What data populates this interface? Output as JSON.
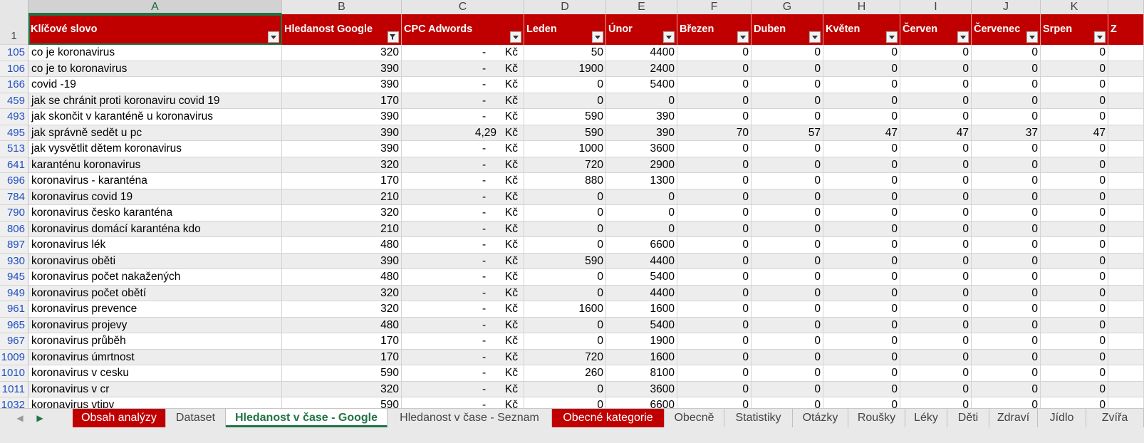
{
  "columns": [
    "A",
    "B",
    "C",
    "D",
    "E",
    "F",
    "G",
    "H",
    "I",
    "J",
    "K"
  ],
  "selected_column": "A",
  "header_row_number": "1",
  "headers": [
    "Klíčové slovo",
    "Hledanost Google",
    "CPC Adwords",
    "Leden",
    "Únor",
    "Březen",
    "Duben",
    "Květen",
    "Červen",
    "Červenec",
    "Srpen",
    "Z"
  ],
  "currency": "Kč",
  "dash": "-",
  "rows": [
    {
      "n": "105",
      "kw": "co je koronavirus",
      "b": "320",
      "cpc": "",
      "d": "50",
      "e": "4400",
      "f": "0",
      "g": "0",
      "h": "0",
      "i": "0",
      "j": "0",
      "k": "0"
    },
    {
      "n": "106",
      "kw": "co je to koronavirus",
      "b": "390",
      "cpc": "",
      "d": "1900",
      "e": "2400",
      "f": "0",
      "g": "0",
      "h": "0",
      "i": "0",
      "j": "0",
      "k": "0"
    },
    {
      "n": "166",
      "kw": "covid -19",
      "b": "390",
      "cpc": "",
      "d": "0",
      "e": "5400",
      "f": "0",
      "g": "0",
      "h": "0",
      "i": "0",
      "j": "0",
      "k": "0"
    },
    {
      "n": "459",
      "kw": "jak se chránit proti koronaviru covid 19",
      "b": "170",
      "cpc": "",
      "d": "0",
      "e": "0",
      "f": "0",
      "g": "0",
      "h": "0",
      "i": "0",
      "j": "0",
      "k": "0"
    },
    {
      "n": "493",
      "kw": "jak skončit v karanténě u koronavirus",
      "b": "390",
      "cpc": "",
      "d": "590",
      "e": "390",
      "f": "0",
      "g": "0",
      "h": "0",
      "i": "0",
      "j": "0",
      "k": "0"
    },
    {
      "n": "495",
      "kw": "jak správně sedět u pc",
      "b": "390",
      "cpc": "4,29",
      "d": "590",
      "e": "390",
      "f": "70",
      "g": "57",
      "h": "47",
      "i": "47",
      "j": "37",
      "k": "47"
    },
    {
      "n": "513",
      "kw": "jak vysvětlit dětem koronavirus",
      "b": "390",
      "cpc": "",
      "d": "1000",
      "e": "3600",
      "f": "0",
      "g": "0",
      "h": "0",
      "i": "0",
      "j": "0",
      "k": "0"
    },
    {
      "n": "641",
      "kw": "karanténu koronavirus",
      "b": "320",
      "cpc": "",
      "d": "720",
      "e": "2900",
      "f": "0",
      "g": "0",
      "h": "0",
      "i": "0",
      "j": "0",
      "k": "0"
    },
    {
      "n": "696",
      "kw": "koronavirus - karanténa",
      "b": "170",
      "cpc": "",
      "d": "880",
      "e": "1300",
      "f": "0",
      "g": "0",
      "h": "0",
      "i": "0",
      "j": "0",
      "k": "0"
    },
    {
      "n": "784",
      "kw": "koronavirus covid 19",
      "b": "210",
      "cpc": "",
      "d": "0",
      "e": "0",
      "f": "0",
      "g": "0",
      "h": "0",
      "i": "0",
      "j": "0",
      "k": "0"
    },
    {
      "n": "790",
      "kw": "koronavirus česko karanténa",
      "b": "320",
      "cpc": "",
      "d": "0",
      "e": "0",
      "f": "0",
      "g": "0",
      "h": "0",
      "i": "0",
      "j": "0",
      "k": "0"
    },
    {
      "n": "806",
      "kw": "koronavirus domácí karanténa kdo",
      "b": "210",
      "cpc": "",
      "d": "0",
      "e": "0",
      "f": "0",
      "g": "0",
      "h": "0",
      "i": "0",
      "j": "0",
      "k": "0"
    },
    {
      "n": "897",
      "kw": "koronavirus lék",
      "b": "480",
      "cpc": "",
      "d": "0",
      "e": "6600",
      "f": "0",
      "g": "0",
      "h": "0",
      "i": "0",
      "j": "0",
      "k": "0"
    },
    {
      "n": "930",
      "kw": "koronavirus oběti",
      "b": "390",
      "cpc": "",
      "d": "590",
      "e": "4400",
      "f": "0",
      "g": "0",
      "h": "0",
      "i": "0",
      "j": "0",
      "k": "0"
    },
    {
      "n": "945",
      "kw": "koronavirus počet nakažených",
      "b": "480",
      "cpc": "",
      "d": "0",
      "e": "5400",
      "f": "0",
      "g": "0",
      "h": "0",
      "i": "0",
      "j": "0",
      "k": "0"
    },
    {
      "n": "949",
      "kw": "koronavirus počet obětí",
      "b": "320",
      "cpc": "",
      "d": "0",
      "e": "4400",
      "f": "0",
      "g": "0",
      "h": "0",
      "i": "0",
      "j": "0",
      "k": "0"
    },
    {
      "n": "961",
      "kw": "koronavirus prevence",
      "b": "320",
      "cpc": "",
      "d": "1600",
      "e": "1600",
      "f": "0",
      "g": "0",
      "h": "0",
      "i": "0",
      "j": "0",
      "k": "0"
    },
    {
      "n": "965",
      "kw": "koronavirus projevy",
      "b": "480",
      "cpc": "",
      "d": "0",
      "e": "5400",
      "f": "0",
      "g": "0",
      "h": "0",
      "i": "0",
      "j": "0",
      "k": "0"
    },
    {
      "n": "967",
      "kw": "koronavirus průběh",
      "b": "170",
      "cpc": "",
      "d": "0",
      "e": "1900",
      "f": "0",
      "g": "0",
      "h": "0",
      "i": "0",
      "j": "0",
      "k": "0"
    },
    {
      "n": "1009",
      "kw": "koronavirus úmrtnost",
      "b": "170",
      "cpc": "",
      "d": "720",
      "e": "1600",
      "f": "0",
      "g": "0",
      "h": "0",
      "i": "0",
      "j": "0",
      "k": "0"
    },
    {
      "n": "1010",
      "kw": "koronavirus v cesku",
      "b": "590",
      "cpc": "",
      "d": "260",
      "e": "8100",
      "f": "0",
      "g": "0",
      "h": "0",
      "i": "0",
      "j": "0",
      "k": "0"
    },
    {
      "n": "1011",
      "kw": "koronavirus v cr",
      "b": "320",
      "cpc": "",
      "d": "0",
      "e": "3600",
      "f": "0",
      "g": "0",
      "h": "0",
      "i": "0",
      "j": "0",
      "k": "0"
    },
    {
      "n": "1032",
      "kw": "koronavirus vtipy",
      "b": "590",
      "cpc": "",
      "d": "0",
      "e": "6600",
      "f": "0",
      "g": "0",
      "h": "0",
      "i": "0",
      "j": "0",
      "k": "0"
    }
  ],
  "sheet_tabs": [
    {
      "label": "Obsah analýzy",
      "style": "red"
    },
    {
      "label": "Dataset",
      "style": "normal"
    },
    {
      "label": "Hledanost v čase - Google",
      "style": "active"
    },
    {
      "label": "Hledanost v čase - Seznam",
      "style": "normal"
    },
    {
      "label": "Obecné kategorie",
      "style": "red"
    },
    {
      "label": "Obecně",
      "style": "normal"
    },
    {
      "label": "Statistiky",
      "style": "normal"
    },
    {
      "label": "Otázky",
      "style": "normal"
    },
    {
      "label": "Roušky",
      "style": "normal"
    },
    {
      "label": "Léky",
      "style": "normal"
    },
    {
      "label": "Děti",
      "style": "normal"
    },
    {
      "label": "Zdraví",
      "style": "normal"
    },
    {
      "label": "Jídlo",
      "style": "normal"
    },
    {
      "label": "Zvířa",
      "style": "normal"
    }
  ],
  "colors": {
    "header_red": "#c00000",
    "excel_green": "#217346",
    "row_number_blue": "#1f4fc1"
  }
}
